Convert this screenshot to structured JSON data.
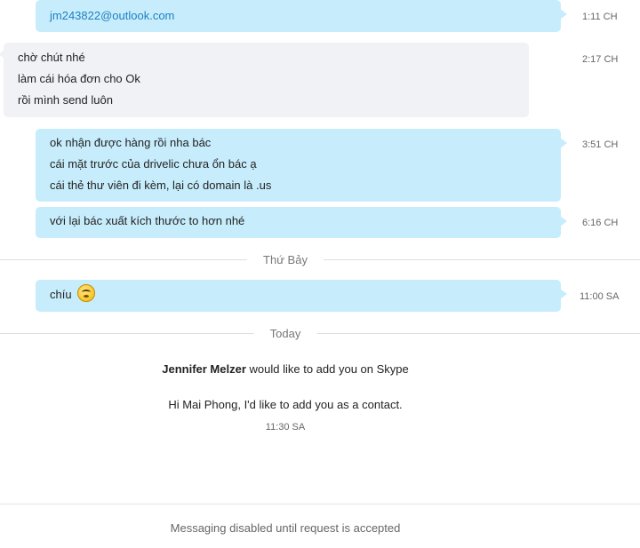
{
  "messages": [
    {
      "lines": [
        "jm243822@outlook.com"
      ],
      "time": "1:11 CH"
    },
    {
      "lines": [
        "chờ chút nhé",
        "làm cái hóa đơn cho Ok",
        "rồi mình send luôn"
      ],
      "time": "2:17 CH"
    },
    {
      "lines": [
        "ok nhận được hàng rồi nha bác",
        "cái mặt trước của drivelic chưa ổn bác ạ",
        "cái thẻ thư viên đi kèm, lại có domain là .us"
      ],
      "time": "3:51 CH"
    },
    {
      "lines": [
        "với lại bác xuất kích thước to hơn nhé"
      ],
      "time": "6:16 CH"
    },
    {
      "lines": [
        "chíu"
      ],
      "time": "11:00 SA",
      "emoji": "smiley-emoji-icon"
    }
  ],
  "dividers": {
    "saturday": "Thứ Bảy",
    "today": "Today"
  },
  "contact_request": {
    "name": "Jennifer Melzer",
    "action_text": "would like to add you on Skype",
    "message": "Hi Mai Phong, I'd like to add you as a contact.",
    "time": "11:30 SA"
  },
  "footer": {
    "status": "Messaging disabled until request is accepted"
  },
  "colors": {
    "outgoing_bubble": "#c7edfc",
    "incoming_bubble": "#f1f2f6",
    "link": "#1f7fc0"
  }
}
